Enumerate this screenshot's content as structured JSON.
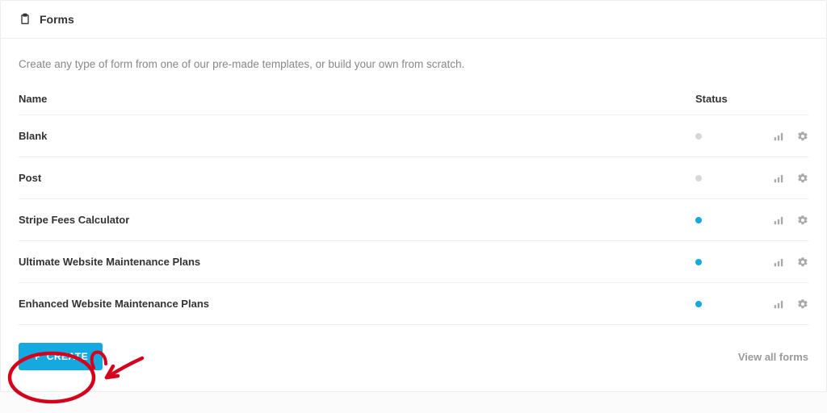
{
  "header": {
    "title": "Forms"
  },
  "intro": "Create any type of form from one of our pre-made templates, or build your own from scratch.",
  "table": {
    "columns": {
      "name": "Name",
      "status": "Status"
    },
    "rows": [
      {
        "name": "Blank",
        "active": false
      },
      {
        "name": "Post",
        "active": false
      },
      {
        "name": "Stripe Fees Calculator",
        "active": true
      },
      {
        "name": "Ultimate Website Maintenance Plans",
        "active": true
      },
      {
        "name": "Enhanced Website Maintenance Plans",
        "active": true
      }
    ]
  },
  "footer": {
    "create": "CREATE",
    "viewAll": "View all forms"
  },
  "colors": {
    "accent": "#14a9e0",
    "annotation": "#d6001c"
  }
}
